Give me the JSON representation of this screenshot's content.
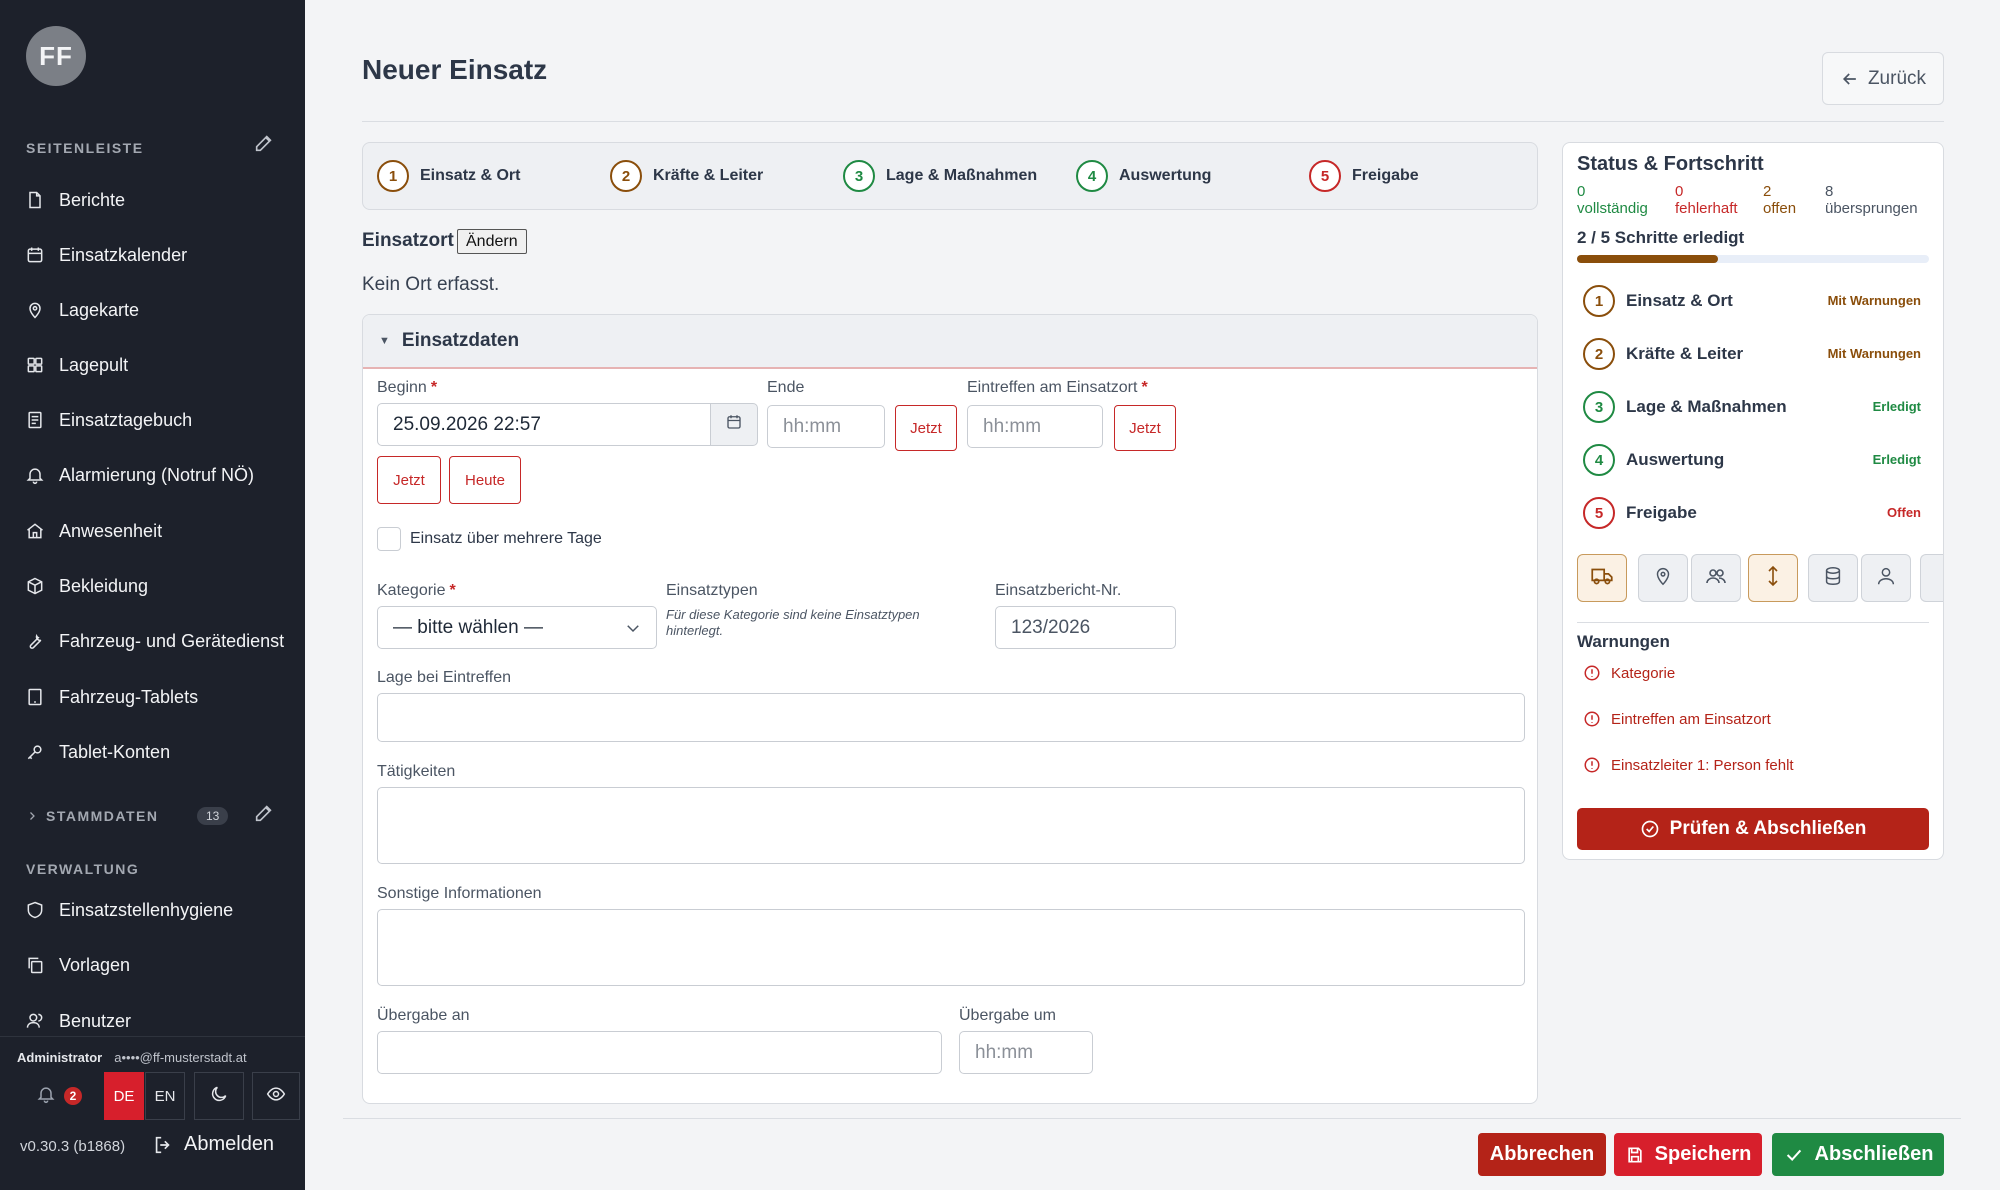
{
  "sidebar": {
    "avatar": "FF",
    "section1": "SEITENLEISTE",
    "items": [
      {
        "label": "Berichte",
        "icon": "file-icon"
      },
      {
        "label": "Einsatzkalender",
        "icon": "calendar-icon"
      },
      {
        "label": "Lagekarte",
        "icon": "map-pin-icon"
      },
      {
        "label": "Lagepult",
        "icon": "grid-icon"
      },
      {
        "label": "Einsatztagebuch",
        "icon": "journal-icon"
      },
      {
        "label": "Alarmierung (Notruf NÖ)",
        "icon": "bell-icon"
      },
      {
        "label": "Anwesenheit",
        "icon": "house-icon"
      },
      {
        "label": "Bekleidung",
        "icon": "box-icon"
      },
      {
        "label": "Fahrzeug- und Gerätedienst",
        "icon": "wrench-icon"
      },
      {
        "label": "Fahrzeug-Tablets",
        "icon": "tablet-icon"
      },
      {
        "label": "Tablet-Konten",
        "icon": "key-icon"
      }
    ],
    "stammdaten": {
      "label": "STAMMDATEN",
      "count": "13"
    },
    "section2": "VERWALTUNG",
    "admin_items": [
      {
        "label": "Einsatzstellenhygiene",
        "icon": "shield-icon"
      },
      {
        "label": "Vorlagen",
        "icon": "copy-icon"
      },
      {
        "label": "Benutzer",
        "icon": "users-icon"
      }
    ],
    "user_role": "Administrator",
    "user_email": "a••••@ff-musterstadt.at",
    "notifications": "2",
    "lang_de": "DE",
    "lang_en": "EN",
    "version": "v0.30.3 (b1868)",
    "logout": "Abmelden"
  },
  "header": {
    "title": "Neuer Einsatz",
    "back": "Zurück"
  },
  "steps": [
    {
      "num": "1",
      "label": "Einsatz & Ort"
    },
    {
      "num": "2",
      "label": "Kräfte & Leiter"
    },
    {
      "num": "3",
      "label": "Lage & Maßnahmen"
    },
    {
      "num": "4",
      "label": "Auswertung"
    },
    {
      "num": "5",
      "label": "Freigabe"
    }
  ],
  "ort": {
    "label": "Einsatzort",
    "change": "Ändern",
    "empty": "Kein Ort erfasst."
  },
  "form": {
    "section": "Einsatzdaten",
    "beginn_label": "Beginn",
    "beginn_value": "25.09.2026 22:57",
    "ende_label": "Ende",
    "ende_placeholder": "hh:mm",
    "eintreffen_label": "Eintreffen am Einsatzort",
    "eintreffen_placeholder": "hh:mm",
    "jetzt": "Jetzt",
    "heute": "Heute",
    "multi_day": "Einsatz über mehrere Tage",
    "kategorie_label": "Kategorie",
    "kategorie_value": "— bitte wählen —",
    "einsatztypen_label": "Einsatztypen",
    "einsatztypen_note": "Für diese Kategorie sind keine Einsatztypen hinterlegt.",
    "bericht_nr_label": "Einsatzbericht-Nr.",
    "bericht_nr_value": "123/2026",
    "lage_label": "Lage bei Eintreffen",
    "taetigkeiten_label": "Tätigkeiten",
    "sonstige_label": "Sonstige Informationen",
    "uebergabe_an_label": "Übergabe an",
    "uebergabe_um_label": "Übergabe um",
    "uebergabe_um_placeholder": "hh:mm"
  },
  "status": {
    "title": "Status & Fortschritt",
    "counts": [
      {
        "n": "0",
        "label": "vollständig"
      },
      {
        "n": "0",
        "label": "fehlerhaft"
      },
      {
        "n": "2",
        "label": "offen"
      },
      {
        "n": "8",
        "label": "übersprungen"
      }
    ],
    "done": "2 / 5 Schritte erledigt",
    "progress": 0.4,
    "rows": [
      {
        "num": "1",
        "label": "Einsatz & Ort",
        "badge": "Mit Warnungen"
      },
      {
        "num": "2",
        "label": "Kräfte & Leiter",
        "badge": "Mit Warnungen"
      },
      {
        "num": "3",
        "label": "Lage & Maßnahmen",
        "badge": "Erledigt"
      },
      {
        "num": "4",
        "label": "Auswertung",
        "badge": "Erledigt"
      },
      {
        "num": "5",
        "label": "Freigabe",
        "badge": "Offen"
      }
    ],
    "warnings_title": "Warnungen",
    "warnings": [
      "Kategorie",
      "Eintreffen am Einsatzort",
      "Einsatzleiter 1: Person fehlt"
    ],
    "check_button": "Prüfen & Abschließen"
  },
  "footer": {
    "cancel": "Abbrechen",
    "save": "Speichern",
    "finish": "Abschließen"
  },
  "colors": {
    "brown": "#8a4e0b",
    "green": "#1f8a43",
    "red": "#c62828",
    "sidebar": "#1d212b"
  }
}
